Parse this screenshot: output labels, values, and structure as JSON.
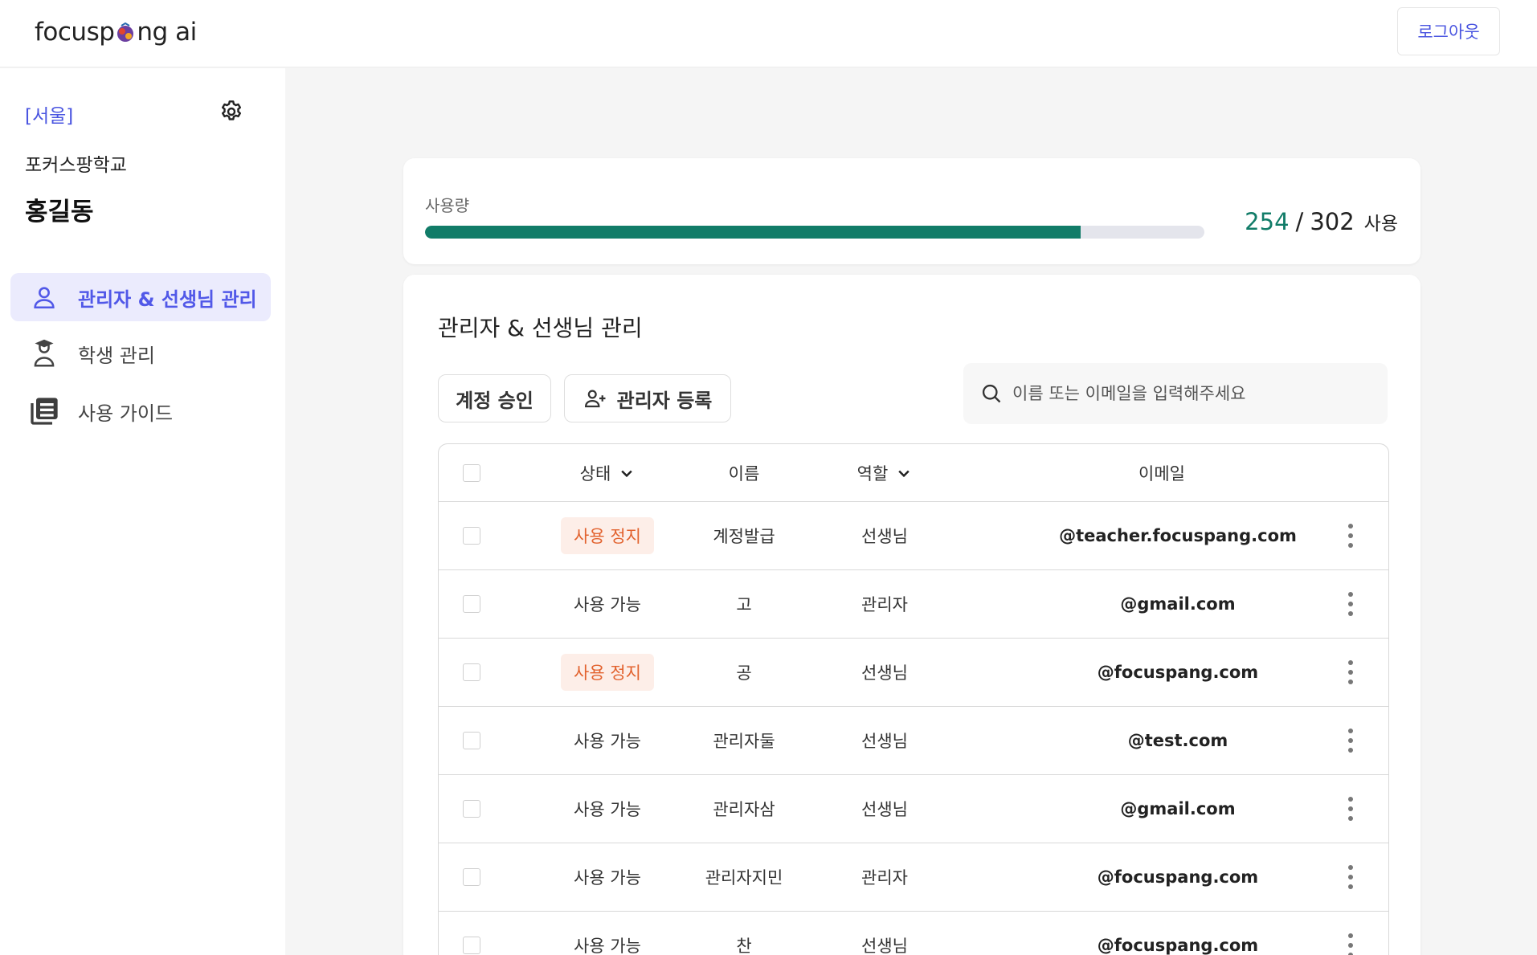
{
  "header": {
    "logo_prefix": "focusp",
    "logo_suffix": "ng ai",
    "logout_label": "로그아웃"
  },
  "sidebar": {
    "region": "[서울]",
    "school": "포커스팡학교",
    "user_name": "홍길동",
    "items": [
      {
        "label": "관리자 & 선생님 관리",
        "icon": "person-icon",
        "active": true
      },
      {
        "label": "학생 관리",
        "icon": "graduate-icon",
        "active": false
      },
      {
        "label": "사용 가이드",
        "icon": "newspaper-icon",
        "active": false
      }
    ]
  },
  "usage": {
    "label": "사용량",
    "used": "254",
    "separator": "/",
    "total": "302",
    "unit": "사용",
    "fraction": 0.841
  },
  "main": {
    "title": "관리자 & 선생님 관리",
    "approve_label": "계정 승인",
    "register_label": "관리자 등록",
    "search_placeholder": "이름 또는 이메일을 입력해주세요"
  },
  "table": {
    "headers": {
      "status": "상태",
      "name": "이름",
      "role": "역할",
      "email": "이메일"
    },
    "rows": [
      {
        "status": "사용 정지",
        "status_type": "stopped",
        "name": "계정발급",
        "role": "선생님",
        "email": "@teacher.focuspang.com"
      },
      {
        "status": "사용 가능",
        "status_type": "ok",
        "name": "고",
        "role": "관리자",
        "email": "@gmail.com"
      },
      {
        "status": "사용 정지",
        "status_type": "stopped",
        "name": "공",
        "role": "선생님",
        "email": "@focuspang.com"
      },
      {
        "status": "사용 가능",
        "status_type": "ok",
        "name": "관리자둘",
        "role": "선생님",
        "email": "@test.com"
      },
      {
        "status": "사용 가능",
        "status_type": "ok",
        "name": "관리자삼",
        "role": "선생님",
        "email": "@gmail.com"
      },
      {
        "status": "사용 가능",
        "status_type": "ok",
        "name": "관리자지민",
        "role": "관리자",
        "email": "@focuspang.com"
      },
      {
        "status": "사용 가능",
        "status_type": "ok",
        "name": "찬",
        "role": "선생님",
        "email": "@focuspang.com"
      }
    ]
  },
  "colors": {
    "accent": "#4a55e0",
    "usage_green": "#117c68",
    "stop_badge_bg": "#fdeee8",
    "stop_badge_text": "#e2622e"
  }
}
